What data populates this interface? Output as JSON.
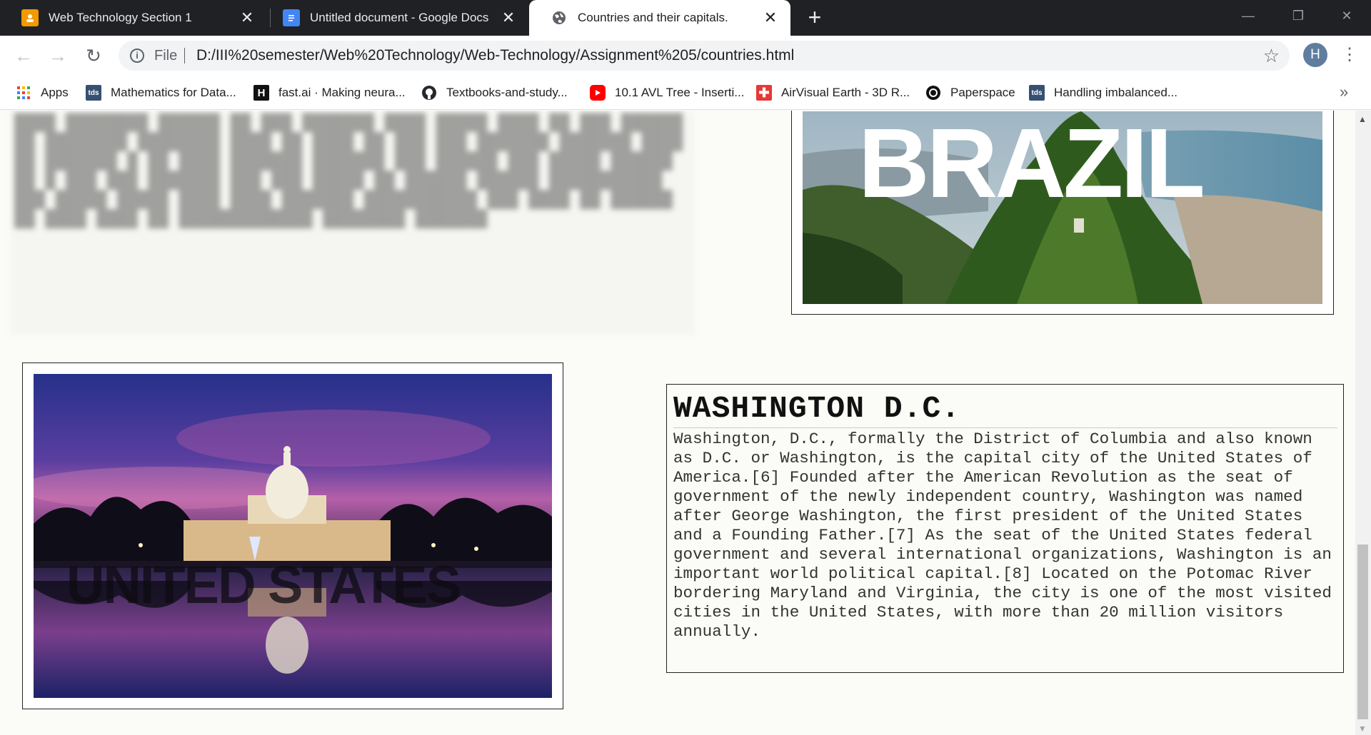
{
  "browser": {
    "tabs": [
      {
        "title": "Web Technology Section 1",
        "icon": "classroom-icon",
        "active": false
      },
      {
        "title": "Untitled document - Google Docs",
        "icon": "docs-icon",
        "active": false
      },
      {
        "title": "Countries and their capitals.",
        "icon": "globe-icon",
        "active": true
      }
    ],
    "new_tab": "+",
    "window_controls": {
      "minimize": "—",
      "restore": "❐",
      "close": "✕"
    },
    "nav": {
      "back": "←",
      "forward": "→",
      "reload": "↻"
    },
    "omnibox": {
      "scheme_label": "File",
      "url": "D:/III%20semester/Web%20Technology/Web-Technology/Assignment%205/countries.html"
    },
    "profile_initial": "H",
    "bookmarks": [
      {
        "label": "Apps",
        "icon": "apps-grid-icon"
      },
      {
        "label": "Mathematics for Data...",
        "icon": "tds-icon"
      },
      {
        "label": "fast.ai · Making neura...",
        "icon": "fastai-icon"
      },
      {
        "label": "Textbooks-and-study...",
        "icon": "github-icon"
      },
      {
        "label": "10.1 AVL Tree - Inserti...",
        "icon": "youtube-icon"
      },
      {
        "label": "AirVisual Earth - 3D R...",
        "icon": "airvisual-icon"
      },
      {
        "label": "Paperspace",
        "icon": "paperspace-icon"
      },
      {
        "label": "Handling imbalanced...",
        "icon": "tds-icon"
      }
    ],
    "bookmarks_overflow": "»"
  },
  "page": {
    "brazil_image_text": "BRAZIL",
    "us_image_text": "UNITED STATES",
    "capital": {
      "title": "WASHINGTON D.C.",
      "text": "Washington, D.C., formally the District of Columbia and also known as D.C. or Washington, is the capital city of the United States of America.[6] Founded after the American Revolution as the seat of government of the newly independent country, Washington was named after George Washington, the first president of the United States and a Founding Father.[7] As the seat of the United States federal government and several international organizations, Washington is an important world political capital.[8] Located on the Potomac River bordering Maryland and Virginia, the city is one of the most visited cities in the United States, with more than 20 million visitors annually."
    }
  }
}
